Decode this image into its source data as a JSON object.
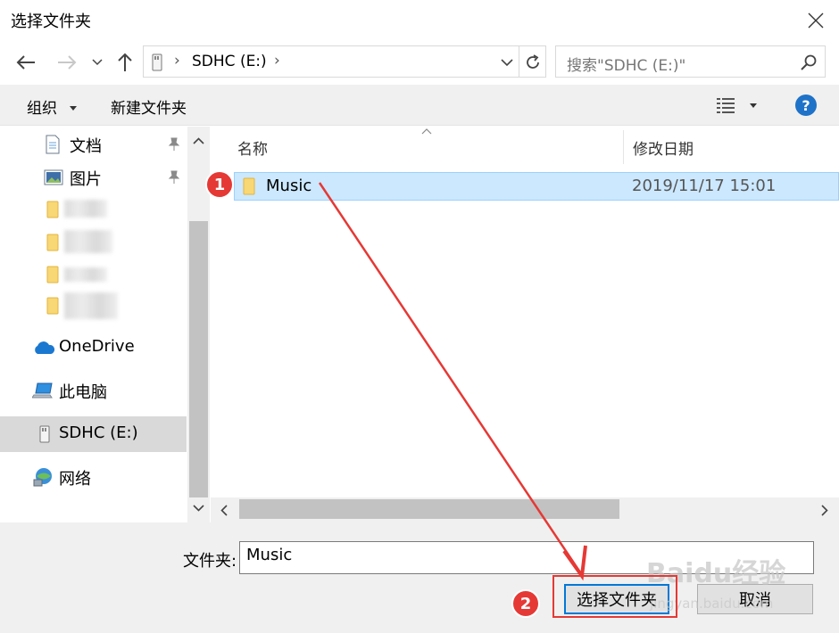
{
  "window": {
    "title": "选择文件夹"
  },
  "address": {
    "location": "SDHC (E:)",
    "separator": "›"
  },
  "search": {
    "placeholder": "搜索\"SDHC (E:)\""
  },
  "toolbar": {
    "organize_label": "组织",
    "new_folder_label": "新建文件夹",
    "help_label": "?"
  },
  "sidebar": {
    "items": [
      {
        "label": "文档",
        "icon": "document-icon",
        "pinned": true
      },
      {
        "label": "图片",
        "icon": "picture-icon",
        "pinned": true
      },
      {
        "label": "",
        "icon": "folder-icon"
      },
      {
        "label": "",
        "icon": "folder-icon"
      },
      {
        "label": "",
        "icon": "folder-icon"
      },
      {
        "label": "",
        "icon": "folder-icon"
      },
      {
        "label": "OneDrive",
        "icon": "cloud-icon"
      },
      {
        "label": "此电脑",
        "icon": "computer-icon"
      },
      {
        "label": "SDHC (E:)",
        "icon": "sd-card-icon",
        "selected": true
      },
      {
        "label": "网络",
        "icon": "network-icon"
      }
    ]
  },
  "table": {
    "columns": [
      "名称",
      "修改日期"
    ],
    "rows": [
      {
        "name": "Music",
        "date": "2019/11/17 15:01",
        "selected": true
      }
    ]
  },
  "footer": {
    "folder_label": "文件夹:",
    "folder_value": "Music",
    "select_button": "选择文件夹",
    "cancel_button": "取消"
  },
  "annotations": {
    "step1": "1",
    "step2": "2",
    "color": "#e53935"
  },
  "watermark": {
    "main": "Baidu经验",
    "sub": "jingyan.baidu.com"
  },
  "colors": {
    "selection": "#cce8ff",
    "accent": "#0078d7",
    "help": "#1e72c8"
  }
}
